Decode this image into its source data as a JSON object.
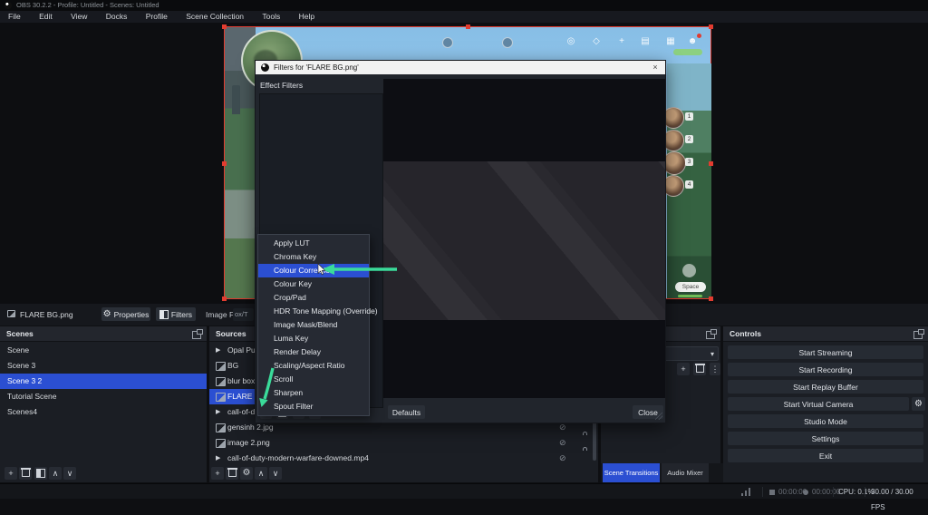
{
  "window": {
    "title": "OBS 30.2.2 - Profile: Untitled - Scenes: Untitled"
  },
  "menu": [
    "File",
    "Edit",
    "View",
    "Docks",
    "Profile",
    "Scene Collection",
    "Tools",
    "Help"
  ],
  "source_row": {
    "name": "FLARE BG.png",
    "properties": "Properties",
    "filters": "Filters",
    "type": "Image File",
    "path_fragment": "ox/T"
  },
  "scenes": {
    "header": "Scenes",
    "items": [
      "Scene",
      "Scene 3",
      "Scene 3 2",
      "Tutorial Scene",
      "Scenes4"
    ],
    "selected": "Scene 3 2"
  },
  "sources": {
    "header": "Sources",
    "items": [
      {
        "label": "Opal Purple",
        "icon": "media-icon"
      },
      {
        "label": "BG",
        "icon": "image-icon"
      },
      {
        "label": "blur box.jpg",
        "icon": "image-icon"
      },
      {
        "label": "FLARE BG.p",
        "icon": "image-icon",
        "selected": true
      },
      {
        "label": "call-of-duty-",
        "icon": "media-icon"
      },
      {
        "label": "gensinh 2.jpg",
        "icon": "image-icon",
        "hidden": true,
        "locked": true
      },
      {
        "label": "image 2.png",
        "icon": "image-icon",
        "hidden": true,
        "locked": true
      },
      {
        "label": "call-of-duty-modern-warfare-downed.mp4",
        "icon": "media-icon",
        "hidden": true,
        "locked": true
      }
    ]
  },
  "transitions": {
    "tabs": [
      "Scene Transitions",
      "Audio Mixer"
    ],
    "selected_tab": "Scene Transitions"
  },
  "controls": {
    "header": "Controls",
    "buttons": [
      "Start Streaming",
      "Start Recording",
      "Start Replay Buffer",
      "Start Virtual Camera",
      "Studio Mode",
      "Settings",
      "Exit"
    ]
  },
  "statusbar": {
    "pause_time": "00:00:00",
    "rec_time": "00:00:00",
    "cpu": "CPU: 0.1%",
    "fps": "30.00 / 30.00 FPS"
  },
  "dialog": {
    "title": "Filters for 'FLARE BG.png'",
    "close": "×",
    "panel_label": "Effect Filters",
    "defaults": "Defaults",
    "close_button": "Close"
  },
  "filter_menu": {
    "items": [
      "Apply LUT",
      "Chroma Key",
      "Colour Correction",
      "Colour Key",
      "Crop/Pad",
      "HDR Tone Mapping (Override)",
      "Image Mask/Blend",
      "Luma Key",
      "Render Delay",
      "Scaling/Aspect Ratio",
      "Scroll",
      "Sharpen",
      "Spout Filter"
    ],
    "highlighted": "Colour Correction"
  },
  "game": {
    "party_slots": [
      "1",
      "2",
      "3",
      "4"
    ],
    "space_button": "Space"
  },
  "colors": {
    "accent_blue": "#2b4fd2",
    "selection_red": "#e23c30",
    "arrow_green": "#3adb9a"
  }
}
